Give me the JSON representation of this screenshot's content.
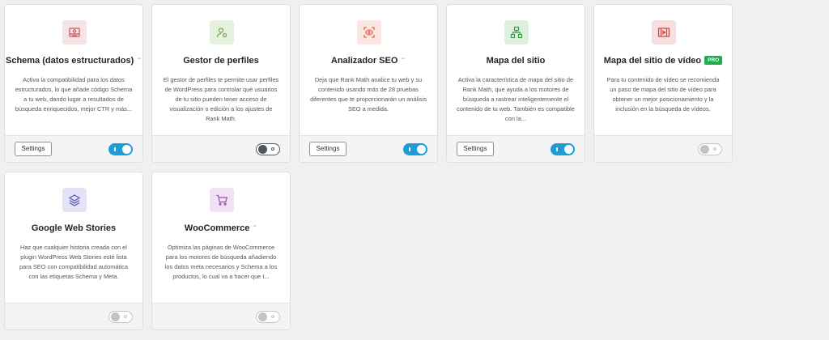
{
  "colors": {
    "toggle_on": "#1e9cd7",
    "pro_badge": "#1fae4f",
    "card_bg": "#ffffff",
    "page_bg": "#f0f0f1"
  },
  "modules": [
    {
      "title": "Schema (datos estructurados)",
      "icon": "schema-icon",
      "caret": "⌃",
      "desc": "Activa la compatibilidad para los datos estructurados, lo que añade código Schema a tu web, dando lugar a resultados de búsqueda enriquecidos, mejor CTR y más...",
      "settings_label": "Settings",
      "state": "on"
    },
    {
      "title": "Gestor de perfiles",
      "icon": "user-settings-icon",
      "desc": "El gestor de perfiles te permite usar perfiles de WordPress para controlar qué usuarios de tu sitio pueden tener acceso de visualización o edición a los ajustes de Rank Math.",
      "state": "off"
    },
    {
      "title": "Analizador SEO",
      "icon": "eye-scan-icon",
      "caret": "⌃",
      "desc": "Deja que Rank Math analice tu web y su contenido usando más de 28 pruebas diferentes que te proporcionarán un análisis SEO a medida.",
      "settings_label": "Settings",
      "state": "on"
    },
    {
      "title": "Mapa del sitio",
      "icon": "sitemap-icon",
      "desc": "Activa la característica de mapa del sitio de Rank Math, que ayuda a los motores de búsqueda a rastrear inteligentemente el contenido de tu web. También es compatible con la...",
      "settings_label": "Settings",
      "state": "on"
    },
    {
      "title": "Mapa del sitio de vídeo",
      "icon": "video-film-icon",
      "badge": "PRO",
      "desc": "Para tu contenido de vídeo se recomienda un paso de mapa del sitio de vídeo para obtener un mejor posicionamiento y la inclusión en la búsqueda de vídeos.",
      "state": "disabled"
    },
    {
      "title": "Google Web Stories",
      "icon": "web-stories-icon",
      "desc": "Haz que cualquier historia creada con el plugin WordPress Web Stories esté lista para SEO con compatibilidad automática con las etiquetas Schema y Meta.",
      "state": "disabled"
    },
    {
      "title": "WooCommerce",
      "icon": "cart-icon",
      "caret": "⌃",
      "desc": "Optimiza las páginas de WooCommerce para los motores de búsqueda añadiendo los datos meta necesarios y Schema a los productos, lo cual va a hacer que t...",
      "state": "disabled"
    }
  ]
}
